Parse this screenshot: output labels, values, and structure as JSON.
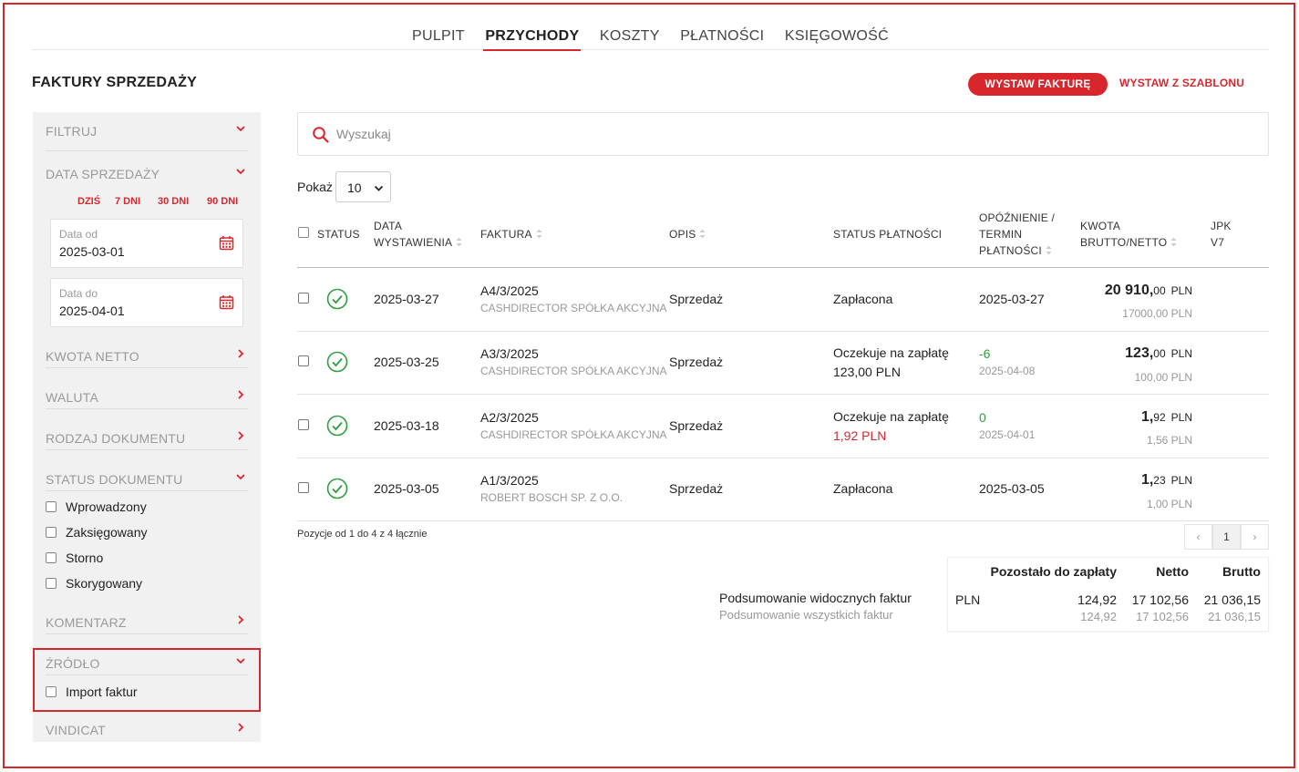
{
  "nav": {
    "items": [
      {
        "label": "PULPIT"
      },
      {
        "label": "PRZYCHODY"
      },
      {
        "label": "KOSZTY"
      },
      {
        "label": "PŁATNOŚCI"
      },
      {
        "label": "KSIĘGOWOŚĆ"
      }
    ],
    "active": "PRZYCHODY"
  },
  "page": {
    "title": "FAKTURY SPRZEDAŻY",
    "primary_button": "WYSTAW FAKTURĘ",
    "secondary_button": "WYSTAW Z SZABLONU"
  },
  "filters": {
    "filter_header": "FILTRUJ",
    "sale_date": {
      "label": "DATA SPRZEDAŻY",
      "quick": [
        "DZIŚ",
        "7 DNI",
        "30 DNI",
        "90 DNI"
      ],
      "from_label": "Data od",
      "from_value": "2025-03-01",
      "to_label": "Data do",
      "to_value": "2025-04-01"
    },
    "net_amount": "KWOTA NETTO",
    "currency": "WALUTA",
    "doc_type": "RODZAJ DOKUMENTU",
    "doc_status": {
      "label": "STATUS DOKUMENTU",
      "options": [
        "Wprowadzony",
        "Zaksięgowany",
        "Storno",
        "Skorygowany"
      ]
    },
    "comment": "KOMENTARZ",
    "source": {
      "label": "ŹRÓDŁO",
      "options": [
        "Import faktur"
      ]
    },
    "vindicat": "VINDICAT"
  },
  "search": {
    "placeholder": "Wyszukaj"
  },
  "page_size": {
    "label": "Pokaż",
    "value": "10"
  },
  "table": {
    "headers": {
      "status": "STATUS",
      "issue_date_1": "DATA",
      "issue_date_2": "WYSTAWIENIA",
      "invoice": "FAKTURA",
      "description": "OPIS",
      "payment_status": "STATUS PŁATNOŚCI",
      "delay_1": "OPÓŹNIENIE /",
      "delay_2": "TERMIN",
      "delay_3": "PŁATNOŚCI",
      "amount_1": "KWOTA",
      "amount_2": "BRUTTO/NETTO",
      "jpk_1": "JPK",
      "jpk_2": "V7"
    },
    "rows": [
      {
        "date": "2025-03-27",
        "invoice": "A4/3/2025",
        "client": "CASHDIRECTOR SPÓŁKA AKCYJNA",
        "description": "Sprzedaż",
        "payment_status": "Zapłacona",
        "payment_amount": "",
        "delay": "2025-03-27",
        "due": "",
        "gross_int": "20 910,",
        "gross_dec": "00",
        "currency": "PLN",
        "net": "17000,00 PLN"
      },
      {
        "date": "2025-03-25",
        "invoice": "A3/3/2025",
        "client": "CASHDIRECTOR SPÓŁKA AKCYJNA",
        "description": "Sprzedaż",
        "payment_status": "Oczekuje na zapłatę",
        "payment_amount": "123,00 PLN",
        "delay": "-6",
        "due": "2025-04-08",
        "gross_int": "123,",
        "gross_dec": "00",
        "currency": "PLN",
        "net": "100,00 PLN"
      },
      {
        "date": "2025-03-18",
        "invoice": "A2/3/2025",
        "client": "CASHDIRECTOR SPÓŁKA AKCYJNA",
        "description": "Sprzedaż",
        "payment_status": "Oczekuje na zapłatę",
        "payment_amount": "1,92 PLN",
        "delay": "0",
        "due": "2025-04-01",
        "gross_int": "1,",
        "gross_dec": "92",
        "currency": "PLN",
        "net": "1,56 PLN"
      },
      {
        "date": "2025-03-05",
        "invoice": "A1/3/2025",
        "client": "ROBERT BOSCH SP. Z O.O.",
        "description": "Sprzedaż",
        "payment_status": "Zapłacona",
        "payment_amount": "",
        "delay": "2025-03-05",
        "due": "",
        "gross_int": "1,",
        "gross_dec": "23",
        "currency": "PLN",
        "net": "1,00 PLN"
      }
    ]
  },
  "pagination": {
    "info": "Pozycje od 1 do 4 z 4 łącznie",
    "prev": "‹",
    "current": "1",
    "next": "›"
  },
  "summary": {
    "caption_visible": "Podsumowanie widocznych faktur",
    "caption_all": "Podsumowanie wszystkich faktur",
    "headers": {
      "remaining": "Pozostało do zapłaty",
      "net": "Netto",
      "gross": "Brutto"
    },
    "currency": "PLN",
    "visible": {
      "remaining": "124,92",
      "net": "17 102,56",
      "gross": "21 036,15"
    },
    "all": {
      "remaining": "124,92",
      "net": "17 102,56",
      "gross": "21 036,15"
    }
  },
  "colors": {
    "accent": "#d8262d",
    "success": "#2e9e3e",
    "danger": "#d8262d"
  }
}
